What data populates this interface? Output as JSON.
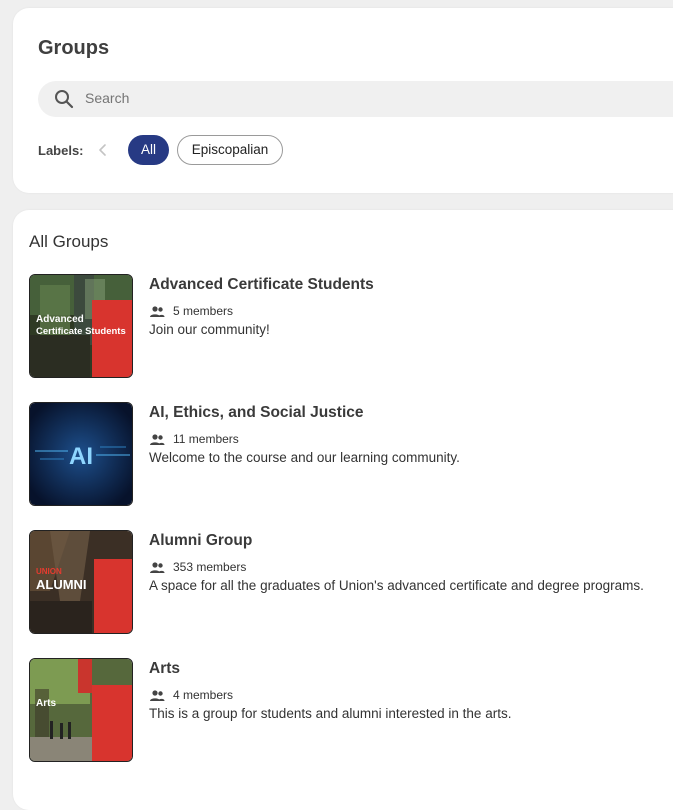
{
  "header": {
    "title": "Groups",
    "search_placeholder": "Search",
    "labels_caption": "Labels:",
    "chips": [
      "All",
      "Episcopalian"
    ],
    "active_chip": "All"
  },
  "section": {
    "title": "All Groups"
  },
  "groups": [
    {
      "name": "Advanced Certificate Students",
      "members": "5 members",
      "description": "Join our community!",
      "thumb_text": [
        "Advanced",
        "Certificate Students"
      ]
    },
    {
      "name": "AI, Ethics, and Social Justice",
      "members": "11 members",
      "description": "Welcome to the course and our learning community.",
      "thumb_text": [
        "AI"
      ]
    },
    {
      "name": "Alumni Group",
      "members": "353 members",
      "description": "A space for all the graduates of Union's advanced certificate and degree programs.",
      "thumb_text": [
        "UNION",
        "ALUMNI"
      ]
    },
    {
      "name": "Arts",
      "members": "4 members",
      "description": "This is a group for students and alumni interested in the arts.",
      "thumb_text": [
        "Arts"
      ]
    }
  ],
  "colors": {
    "accent": "#273a84",
    "brand_red": "#d8342e"
  },
  "icons": {
    "search": "search-icon",
    "members": "people-icon",
    "scroll_left": "chevron-left-icon"
  }
}
